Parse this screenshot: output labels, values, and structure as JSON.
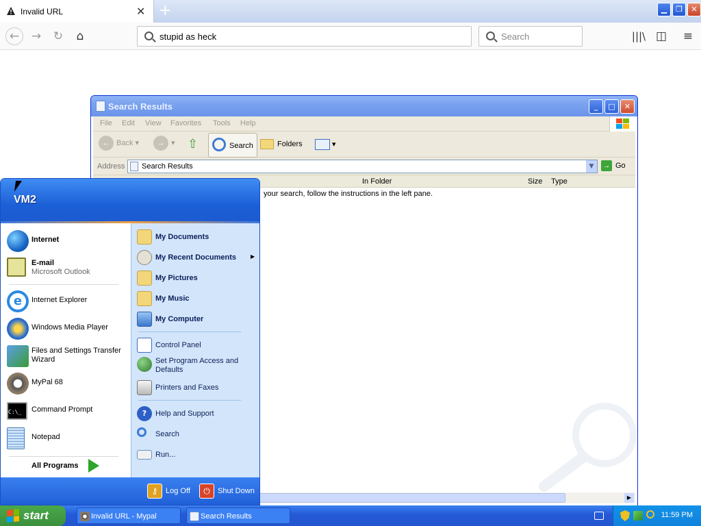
{
  "browser": {
    "tab_title": "Invalid URL",
    "url_value": "stupid as heck",
    "search_placeholder": "Search"
  },
  "explorer": {
    "title": "Search Results",
    "menu": [
      "File",
      "Edit",
      "View",
      "Favorites",
      "Tools",
      "Help"
    ],
    "toolbar": {
      "back": "Back",
      "search": "Search",
      "folders": "Folders"
    },
    "address_label": "Address",
    "address_value": "Search Results",
    "go": "Go",
    "columns": [
      "In Folder",
      "Size",
      "Type"
    ],
    "message": "your search, follow the instructions in the left pane."
  },
  "start_menu": {
    "user": "VM2",
    "pinned": [
      {
        "name": "Internet",
        "sub": ""
      },
      {
        "name": "E-mail",
        "sub": "Microsoft Outlook"
      }
    ],
    "recent": [
      {
        "name": "Internet Explorer"
      },
      {
        "name": "Windows Media Player"
      },
      {
        "name": "Files and Settings Transfer Wizard"
      },
      {
        "name": "MyPal 68"
      },
      {
        "name": "Command Prompt"
      },
      {
        "name": "Notepad"
      }
    ],
    "all_programs": "All Programs",
    "places": [
      {
        "name": "My Documents"
      },
      {
        "name": "My Recent Documents"
      },
      {
        "name": "My Pictures"
      },
      {
        "name": "My Music"
      },
      {
        "name": "My Computer"
      }
    ],
    "system": [
      {
        "name": "Control Panel"
      },
      {
        "name": "Set Program Access and Defaults"
      },
      {
        "name": "Printers and Faxes"
      }
    ],
    "tools": [
      {
        "name": "Help and Support"
      },
      {
        "name": "Search"
      },
      {
        "name": "Run..."
      }
    ],
    "log_off": "Log Off",
    "shut_down": "Shut Down"
  },
  "taskbar": {
    "start": "start",
    "tasks": [
      "Invalid URL - Mypal",
      "Search Results"
    ],
    "clock": "11:59 PM"
  }
}
